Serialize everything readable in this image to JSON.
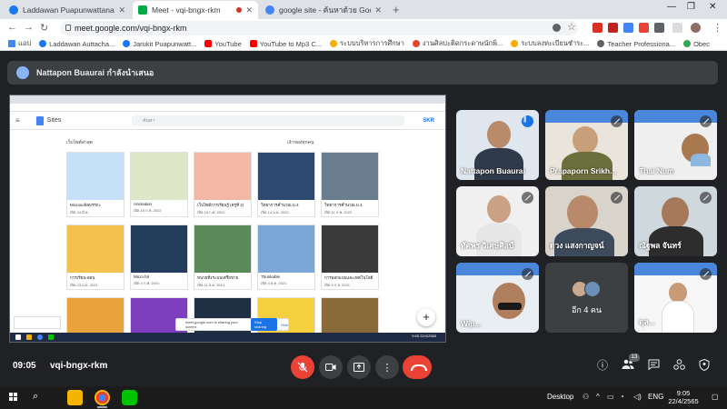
{
  "browser": {
    "tabs": [
      {
        "label": "Laddawan Puapunwattana | Facebook",
        "favicon_color": "#1877f2"
      },
      {
        "label": "Meet - vqi-bngx-rkm",
        "favicon_color": "#00ac47"
      },
      {
        "label": "google site - ค้นหาด้วย Google",
        "favicon_color": "#4285f4"
      }
    ],
    "address": "meet.google.com/vqi-bngx-rkm",
    "bookmarks": [
      {
        "label": "แอป",
        "color": "#4285f4"
      },
      {
        "label": "Laddawan Auttacha...",
        "color": "#1877f2"
      },
      {
        "label": "Jarukit Puapunwatt...",
        "color": "#1877f2"
      },
      {
        "label": "YouTube",
        "color": "#ff0000"
      },
      {
        "label": "YouTube to Mp3 C...",
        "color": "#ff0000"
      },
      {
        "label": "ระบบบริหารการศึกษา",
        "color": "#f9ab00"
      },
      {
        "label": "งานศิลปะติดกระดาษนักพิ...",
        "color": "#ea4335"
      },
      {
        "label": "ระบบลงทะเบียนชำระ...",
        "color": "#f9ab00"
      },
      {
        "label": "Teacher Professiona...",
        "color": "#5f6368"
      },
      {
        "label": "Obec",
        "color": "#34a853"
      }
    ]
  },
  "meet": {
    "presenter_banner": "Nattapon Buaurai กำลังนำเสนอ",
    "clock": "09:05",
    "meeting_code": "vqi-bngx-rkm",
    "participant_count": "13",
    "more_participants": "อีก 4 คน",
    "participants": [
      {
        "name": "Nattapon Buaurai",
        "speaking": true
      },
      {
        "name": "Prapaporn Srikh...",
        "speaking": false
      },
      {
        "name": "Thai Num",
        "speaking": false
      },
      {
        "name": "ทัศพร วิเศษศิลป์",
        "speaking": false
      },
      {
        "name": "ดวง แสงกาญจน์",
        "speaking": false
      },
      {
        "name": "ณัฐพล จันทร์",
        "speaking": false
      },
      {
        "name": "Wip...",
        "speaking": false
      },
      {
        "name": "ดุล...",
        "speaking": false
      }
    ]
  },
  "shared_screen": {
    "app_name": "Sites",
    "search_placeholder": "ค้นหา",
    "account": "SKR",
    "recent_label": "เว็บไซต์ล่าสุด",
    "owner_filter": "เจ้าของทุกคน",
    "sites": [
      {
        "title": "Microsoftสมรรถะ",
        "date": "เปิด 24 มี.ค.",
        "color": "#c6e0f7"
      },
      {
        "title": "Animation",
        "date": "เปิด 16 ก.พ. 2022",
        "color": "#dde7c8"
      },
      {
        "title": "เว็บไซต์การเรียนรู้ (ครูที่ 2)",
        "date": "เปิด 15 ก.พ. 2022",
        "color": "#f2b8a5"
      },
      {
        "title": "วิทยาการคำนวณ ม.4",
        "date": "เปิด 14 ม.ค. 2022",
        "color": "#2c4a70"
      },
      {
        "title": "วิทยาการคำนวณ ม.4",
        "date": "เปิด 11 ก.พ. 2022",
        "color": "#6a7d8f"
      },
      {
        "title": "การเรียน-สอน",
        "date": "เปิด 23 ม.ค. 2021",
        "color": "#f4c14e"
      },
      {
        "title": "Micro bit",
        "date": "เปิด 4 ก.พ. 2021",
        "color": "#243d5c"
      },
      {
        "title": "หน่วยที่1ระบบเครือข่าย",
        "date": "เปิด 11 ธ.ค. 2021",
        "color": "#5b8a5a"
      },
      {
        "title": "Thunkable",
        "date": "เปิด 4 ธ.ค. 2021",
        "color": "#7aa7d8"
      },
      {
        "title": "การออกแบบและเทคโนโลยี",
        "date": "เปิด 9 ก.ย. 2021",
        "color": "#3a3a3a"
      },
      {
        "title": "",
        "date": "",
        "color": "#e8a33c"
      },
      {
        "title": "",
        "date": "",
        "color": "#7e3fbf"
      },
      {
        "title": "",
        "date": "",
        "color": "#1f2f44"
      },
      {
        "title": "",
        "date": "",
        "color": "#f4d03f"
      },
      {
        "title": "",
        "date": "",
        "color": "#8a6a3a"
      }
    ],
    "toast_text": "meet.google.com is sharing your screen.",
    "toast_stop": "Stop sharing",
    "toast_hide": "Hide",
    "inner_time": "9:05",
    "inner_date": "22/4/2565"
  },
  "taskbar": {
    "desktop_label": "Desktop",
    "lang": "ENG",
    "time": "9:05",
    "date": "22/4/2565"
  }
}
